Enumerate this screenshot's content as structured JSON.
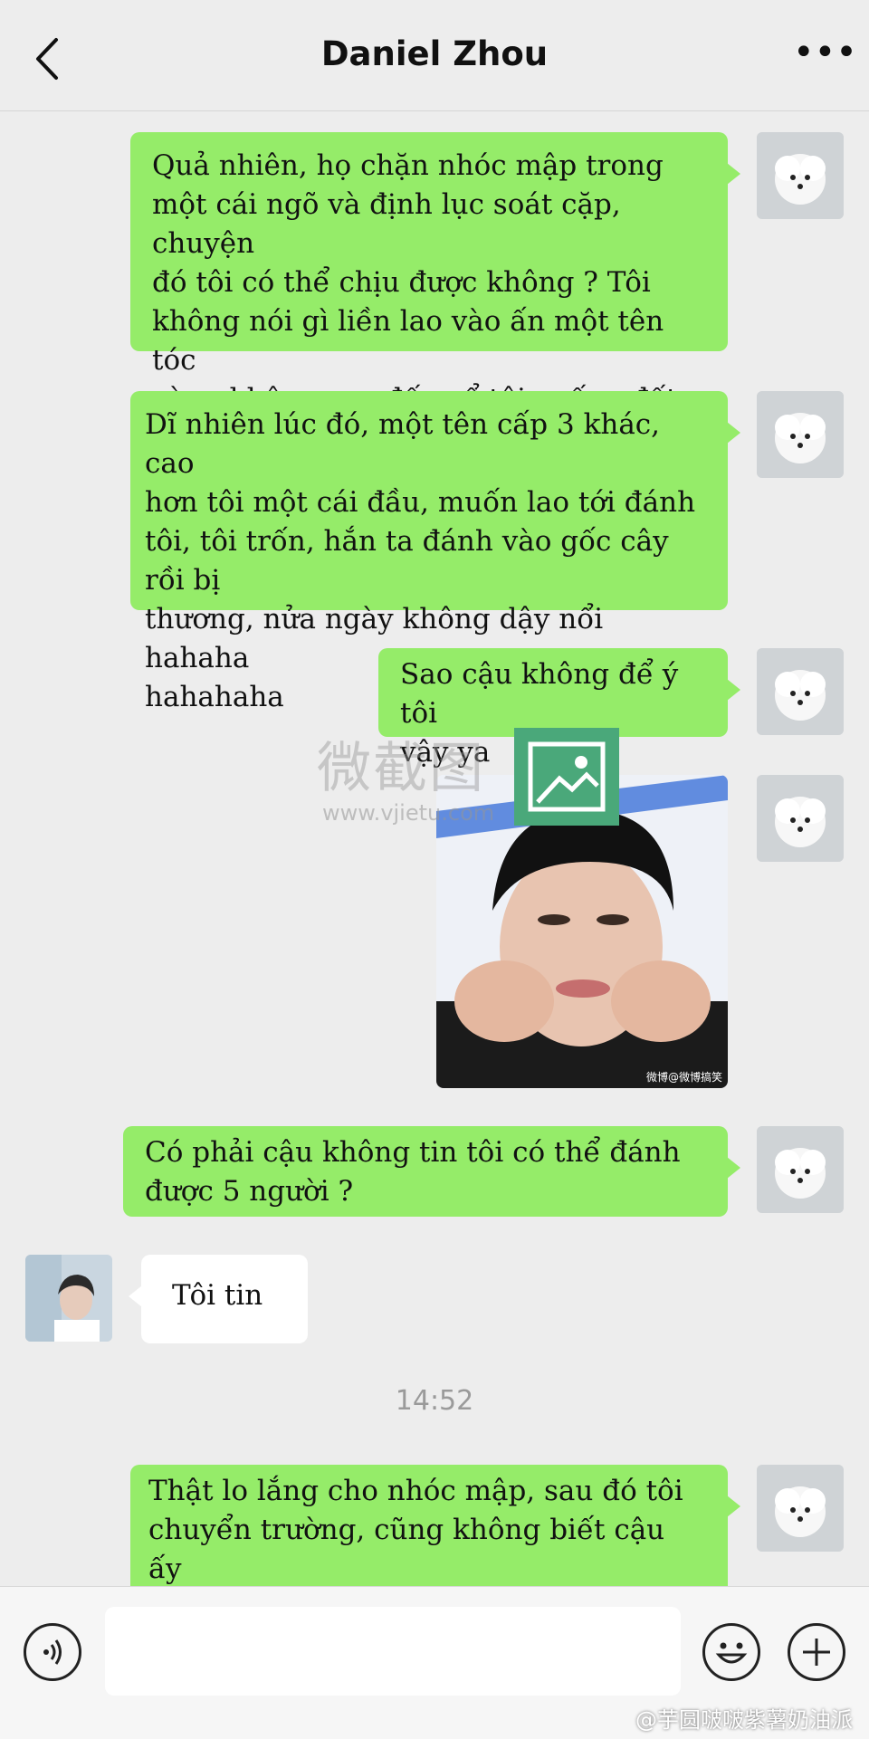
{
  "header": {
    "title": "Daniel Zhou",
    "back_icon": "chevron-left-icon",
    "more_icon": "ellipsis-icon"
  },
  "messages": [
    {
      "sender": "me",
      "text": "Quả nhiên, họ chặn nhóc mập trong\nmột cái ngõ và định lục soát cặp, chuyện\nđó tôi có thể chịu được không ? Tôi\nkhông nói gì liền lao vào ấn một tên tóc\nvàng không cao đến cổ tôi xuống đất"
    },
    {
      "sender": "me",
      "text": "Dĩ nhiên lúc đó, một tên cấp 3 khác, cao\nhơn tôi một cái đầu, muốn lao tới đánh\ntôi, tôi trốn, hắn ta đánh vào gốc cây rồi bị\nthương, nửa ngày không dậy nổi hahaha\nhahahaha"
    },
    {
      "sender": "me",
      "text": "Sao cậu không để ý tôi\nvậy ya"
    },
    {
      "sender": "me",
      "type": "image",
      "text": ""
    },
    {
      "sender": "me",
      "text": "Có phải cậu không tin tôi có thể đánh\nđược 5 người ?"
    },
    {
      "sender": "them",
      "text": "Tôi tin"
    },
    {
      "sender": "me",
      "text": "Thật lo lắng cho nhóc mập, sau đó tôi\nchuyển trường, cũng không biết cậu ấy\nthế nào rồi"
    }
  ],
  "timestamp": "14:52",
  "watermark": {
    "text": "微截图",
    "url": "www.vjietu.com"
  },
  "image_caption": "微博@微博搞笑",
  "input_bar": {
    "voice_icon": "voice-icon",
    "emoji_icon": "emoji-icon",
    "plus_icon": "plus-icon"
  },
  "footer_watermark": "@芋圆啵啵紫薯奶油派",
  "colors": {
    "my_bubble": "#95ec69",
    "their_bubble": "#ffffff",
    "background": "#ededed"
  }
}
